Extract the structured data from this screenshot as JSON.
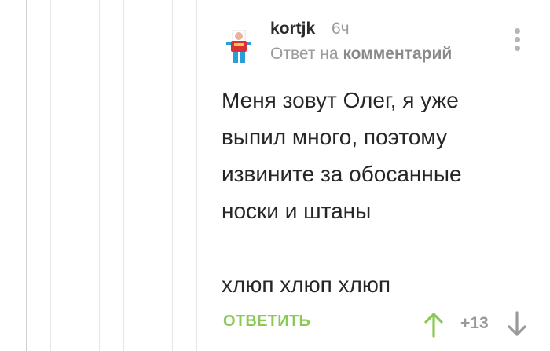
{
  "comment": {
    "author": "kortjk",
    "time": "6ч",
    "reply_prefix": "Ответ на",
    "reply_link": "комментарий",
    "paragraphs": [
      "Меня зовут Олег, я уже выпил много, поэтому извините за обосанные носки и штаны",
      "хлюп хлюп хлюп"
    ],
    "reply_button": "ОТВЕТИТЬ",
    "rating": "+13",
    "icons": {
      "avatar": "avatar-figure-icon",
      "menu": "more-vertical-icon",
      "upvote": "arrow-up-icon",
      "downvote": "arrow-down-icon"
    },
    "colors": {
      "accent_green": "#8ac858",
      "muted": "#9a9a9a",
      "text": "#262626"
    }
  }
}
